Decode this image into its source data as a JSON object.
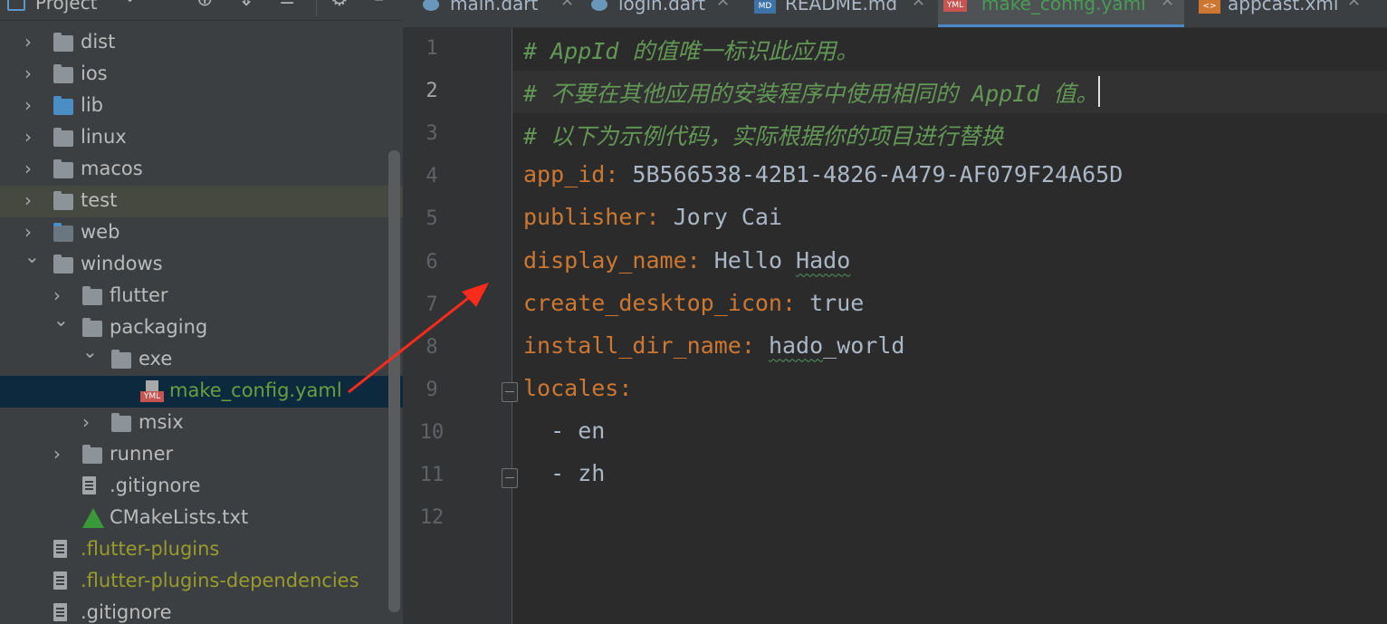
{
  "project_panel": {
    "title": "Project",
    "tree": [
      {
        "label": "dist",
        "depth": 0,
        "expanded": false,
        "icon": "folder-icon"
      },
      {
        "label": "ios",
        "depth": 0,
        "expanded": false,
        "icon": "ios-folder-icon"
      },
      {
        "label": "lib",
        "depth": 0,
        "expanded": false,
        "icon": "source-folder-icon"
      },
      {
        "label": "linux",
        "depth": 0,
        "expanded": false,
        "icon": "folder-icon"
      },
      {
        "label": "macos",
        "depth": 0,
        "expanded": false,
        "icon": "folder-icon"
      },
      {
        "label": "test",
        "depth": 0,
        "expanded": false,
        "icon": "test-folder-icon"
      },
      {
        "label": "web",
        "depth": 0,
        "expanded": false,
        "icon": "web-folder-icon"
      },
      {
        "label": "windows",
        "depth": 0,
        "expanded": true,
        "icon": "folder-icon"
      },
      {
        "label": "flutter",
        "depth": 1,
        "expanded": false,
        "icon": "folder-icon"
      },
      {
        "label": "packaging",
        "depth": 1,
        "expanded": true,
        "icon": "folder-icon"
      },
      {
        "label": "exe",
        "depth": 2,
        "expanded": true,
        "icon": "folder-icon"
      },
      {
        "label": "make_config.yaml",
        "depth": 3,
        "icon": "yaml-file-icon",
        "icon_text": "YML"
      },
      {
        "label": "msix",
        "depth": 2,
        "expanded": false,
        "icon": "folder-icon"
      },
      {
        "label": "runner",
        "depth": 1,
        "expanded": false,
        "icon": "folder-icon"
      },
      {
        "label": ".gitignore",
        "depth": 1,
        "icon": "gitignore-file-icon"
      },
      {
        "label": "CMakeLists.txt",
        "depth": 1,
        "icon": "cmake-file-icon"
      },
      {
        "label": ".flutter-plugins",
        "depth": 0,
        "icon": "text-file-icon"
      },
      {
        "label": ".flutter-plugins-dependencies",
        "depth": 0,
        "icon": "text-file-icon"
      },
      {
        "label": ".gitignore",
        "depth": 0,
        "icon": "gitignore-file-icon"
      }
    ]
  },
  "tabs": [
    {
      "label": "main.dart",
      "icon": "dart-file-icon"
    },
    {
      "label": "login.dart",
      "icon": "dart-file-icon"
    },
    {
      "label": "README.md",
      "icon": "markdown-file-icon",
      "icon_text": "MD"
    },
    {
      "label": "make_config.yaml",
      "icon": "yaml-file-icon",
      "icon_text": "YML",
      "active": true
    },
    {
      "label": "appcast.xml",
      "icon": "xml-file-icon",
      "icon_text": "<>"
    }
  ],
  "editor": {
    "current_line": 2,
    "lines": [
      {
        "no": "1",
        "comment": "# AppId 的值唯一标识此应用。"
      },
      {
        "no": "2",
        "comment": "# 不要在其他应用的安装程序中使用相同的 AppId 值。"
      },
      {
        "no": "3",
        "comment": "# 以下为示例代码，实际根据你的项目进行替换"
      },
      {
        "no": "4",
        "key": "app_id",
        "value": "5B566538-42B1-4826-A479-AF079F24A65D"
      },
      {
        "no": "5",
        "key": "publisher",
        "value": "Jory Cai"
      },
      {
        "no": "6",
        "key": "display_name",
        "value_plain": "Hello ",
        "value_squiggle": "Hado"
      },
      {
        "no": "7",
        "key": "create_desktop_icon",
        "value": "true"
      },
      {
        "no": "8",
        "key": "install_dir_name",
        "value_squiggle": "hado",
        "value_plain_after": "_world"
      },
      {
        "no": "9",
        "key": "locales",
        "value": ""
      },
      {
        "no": "10",
        "list_item": "en"
      },
      {
        "no": "11",
        "list_item": "zh"
      },
      {
        "no": "12"
      }
    ]
  },
  "colors": {
    "comment": "#629755",
    "key": "#cc7832",
    "value": "#a9b7c6",
    "annotation_arrow": "#ff2a1a",
    "selection": "#0d293e"
  }
}
